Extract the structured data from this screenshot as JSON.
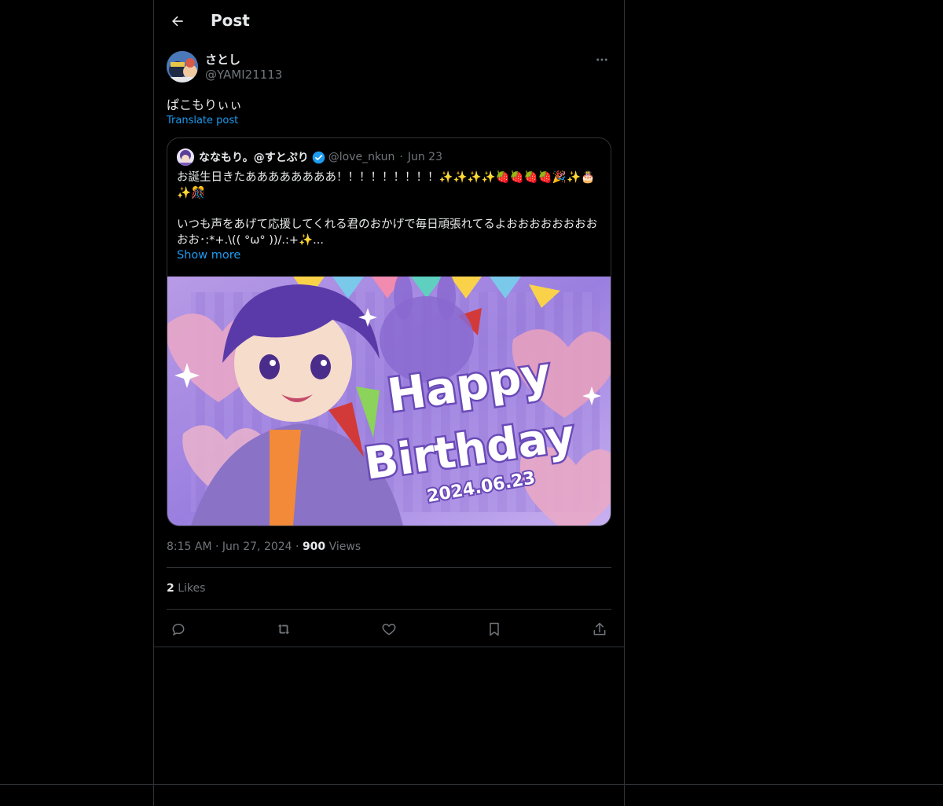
{
  "header": {
    "title": "Post",
    "back_icon": "arrow-left-icon"
  },
  "author": {
    "name": "さとし",
    "handle": "@YAMI21113",
    "more_icon": "more-horizontal-icon"
  },
  "post": {
    "text": "ぱこもりぃぃ",
    "translate_label": "Translate post"
  },
  "quote": {
    "name": "ななもり。@すとぷり",
    "verified_icon": "verified-badge-icon",
    "handle": "@love_nkun",
    "date": "Jun 23",
    "text": "お誕生日きたああああああああ！！！！！！！！！✨✨✨✨🍓🍓🍓🍓🎉✨🎂✨🎊\n\nいつも声をあげて応援してくれる君のおかげで毎日頑張れてるよおおおおおおおおおお･:*+.\\(( °ω° ))/.:+✨...",
    "show_more": "Show more",
    "image": {
      "headline_1": "Happy",
      "headline_2": "Birthday",
      "date_text": "2024.06.23"
    }
  },
  "meta": {
    "time": "8:15 AM",
    "date": "Jun 27, 2024",
    "views_count": "900",
    "views_label": "Views"
  },
  "likes": {
    "count": "2",
    "label": "Likes"
  },
  "actions": {
    "reply_icon": "reply-icon",
    "repost_icon": "repost-icon",
    "like_icon": "heart-icon",
    "bookmark_icon": "bookmark-icon",
    "share_icon": "share-icon"
  },
  "colors": {
    "background": "#000000",
    "link": "#1d9bf0",
    "muted": "#71767b",
    "text": "#e7e9ea",
    "border": "#2f3336"
  }
}
